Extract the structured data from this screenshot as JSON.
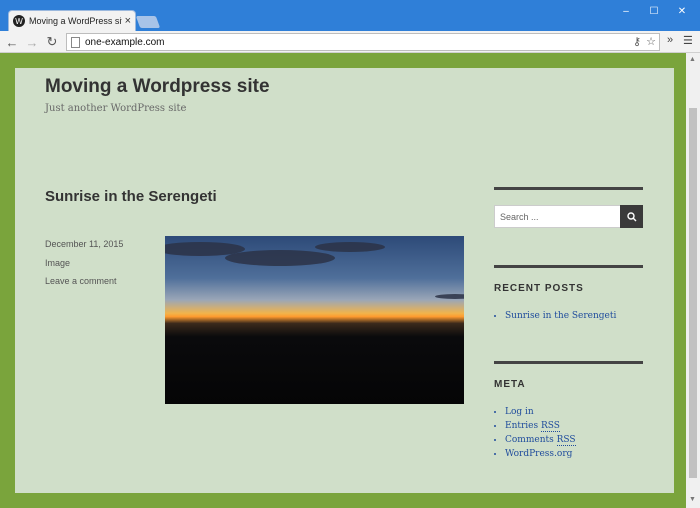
{
  "browser": {
    "tab_title": "Moving a WordPress site -",
    "tab_close": "×",
    "address": "one-example.com",
    "extensions_label": "»",
    "window_min": "–",
    "window_max": "☐",
    "window_close": "✕"
  },
  "site": {
    "title": "Moving a Wordpress site",
    "tagline": "Just another WordPress site"
  },
  "post": {
    "title": "Sunrise in the Serengeti",
    "date": "December 11, 2015",
    "format": "Image",
    "comment_link": "Leave a comment"
  },
  "sidebar": {
    "search_placeholder": "Search ...",
    "recent_posts_title": "RECENT POSTS",
    "recent_posts": [
      "Sunrise in the Serengeti"
    ],
    "meta_title": "META",
    "meta_links": {
      "login": "Log in",
      "entries_prefix": "Entries",
      "comments_prefix": "Comments",
      "rss": "RSS",
      "wordpress": "WordPress.org"
    }
  },
  "colors": {
    "page_bg": "#d0dfc9",
    "frame_bg": "#7aa43c",
    "link": "#1f4c9c"
  }
}
